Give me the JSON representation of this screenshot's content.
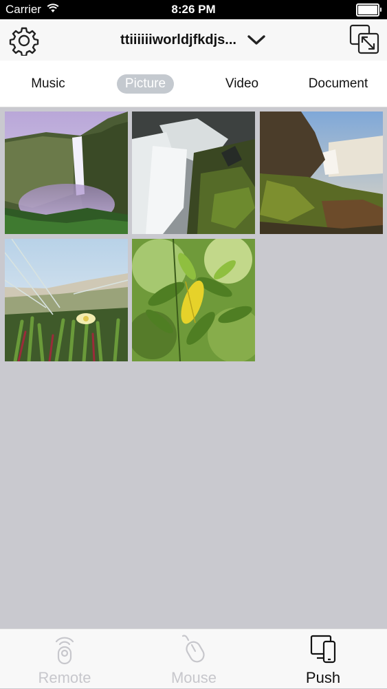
{
  "status_bar": {
    "carrier": "Carrier",
    "time": "8:26 PM",
    "wifi_icon": "wifi-icon",
    "battery_icon": "battery-icon"
  },
  "nav": {
    "device_name": "ttiiiiiiworldjfkdjs...",
    "settings_icon": "gear-icon",
    "dropdown_icon": "chevron-down-icon",
    "screen_icon": "screen-mirror-icon"
  },
  "media_tabs": [
    {
      "label": "Music",
      "selected": false
    },
    {
      "label": "Picture",
      "selected": true
    },
    {
      "label": "Video",
      "selected": false
    },
    {
      "label": "Document",
      "selected": false
    }
  ],
  "pictures": [
    {
      "subject": "waterfall-cliff"
    },
    {
      "subject": "waterfall-rocks"
    },
    {
      "subject": "waterfall-mossy"
    },
    {
      "subject": "beach-grass-flower"
    },
    {
      "subject": "green-leaves"
    }
  ],
  "bottom_tabs": [
    {
      "label": "Remote",
      "icon": "remote-icon",
      "active": false
    },
    {
      "label": "Mouse",
      "icon": "mouse-icon",
      "active": false
    },
    {
      "label": "Push",
      "icon": "push-devices-icon",
      "active": true
    }
  ],
  "colors": {
    "selected_tab_bg": "#c4c9cf",
    "inactive_tab": "#c7c7cc",
    "grid_bg": "#c9c9cf"
  }
}
